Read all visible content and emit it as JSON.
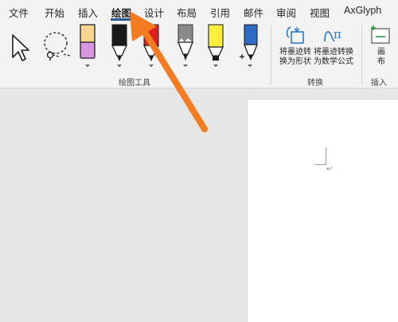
{
  "tabs": [
    {
      "label": "文件"
    },
    {
      "label": "开始"
    },
    {
      "label": "插入"
    },
    {
      "label": "绘图",
      "active": true
    },
    {
      "label": "设计"
    },
    {
      "label": "布局"
    },
    {
      "label": "引用"
    },
    {
      "label": "邮件"
    },
    {
      "label": "审阅"
    },
    {
      "label": "视图"
    },
    {
      "label": "AxGlyph"
    }
  ],
  "ribbon": {
    "draw_tools": {
      "label": "绘图工具",
      "tools": [
        {
          "name": "select",
          "icon": "select-arrow-icon"
        },
        {
          "name": "lasso",
          "icon": "lasso-select-icon"
        },
        {
          "name": "pen-1",
          "icon": "pen-icon",
          "color": "#d896e0"
        },
        {
          "name": "pen-2",
          "icon": "pen-icon",
          "color": "#1a1a1a"
        },
        {
          "name": "pen-3",
          "icon": "pen-icon",
          "color": "#e02020"
        },
        {
          "name": "pen-4",
          "icon": "pencil-icon",
          "color": "#8a8a8a"
        },
        {
          "name": "highlighter",
          "icon": "highlighter-icon",
          "color": "#ffef3a"
        },
        {
          "name": "action-pen",
          "icon": "action-pen-icon",
          "color": "#2e6cc4"
        }
      ]
    },
    "convert": {
      "label": "转换",
      "ink_to_shape": "将墨迹转\n换为形状",
      "ink_to_math": "将墨迹转换\n为数学公式"
    },
    "insert": {
      "label": "插入",
      "canvas": "画\n布"
    }
  },
  "document": {
    "paragraph_mark": "↵"
  },
  "colors": {
    "accent": "#2b579a",
    "annotation_arrow": "#f47b20"
  }
}
